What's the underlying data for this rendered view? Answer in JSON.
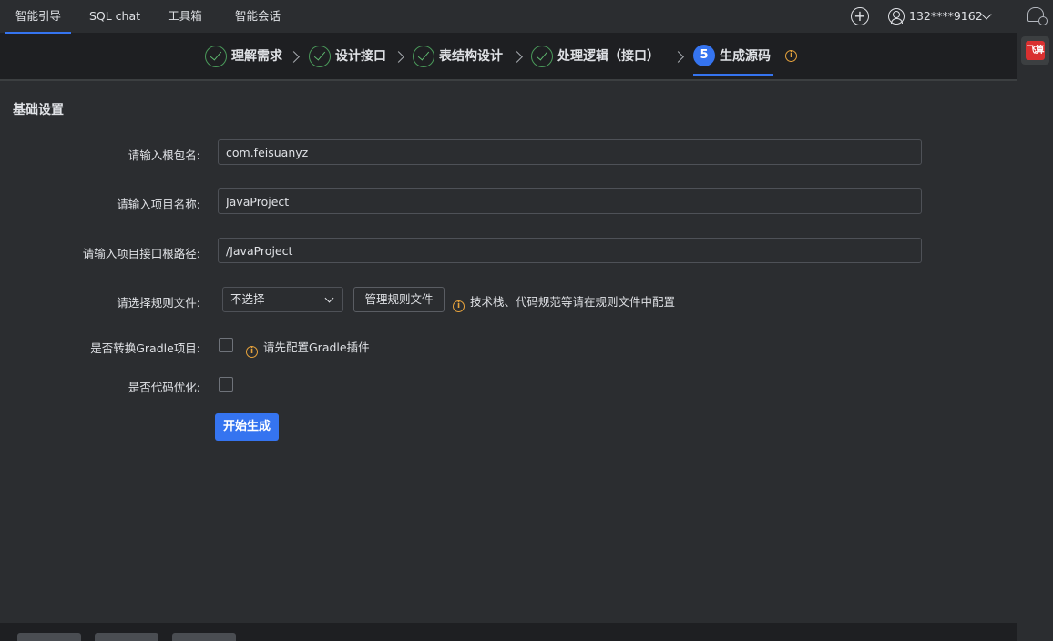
{
  "tabs": [
    {
      "label": "智能引导",
      "active": true
    },
    {
      "label": "SQL chat",
      "active": false
    },
    {
      "label": "工具箱",
      "active": false
    },
    {
      "label": "智能会话",
      "active": false
    }
  ],
  "user": {
    "name": "132****9162"
  },
  "side": {
    "app_logo_text": "飞算"
  },
  "steps": [
    {
      "label": "理解需求",
      "status": "done"
    },
    {
      "label": "设计接口",
      "status": "done"
    },
    {
      "label": "表结构设计",
      "status": "done"
    },
    {
      "label": "处理逻辑（接口）",
      "status": "done"
    },
    {
      "label": "生成源码",
      "status": "active",
      "number": "5"
    }
  ],
  "form": {
    "section_title": "基础设置",
    "root_package_label": "请输入根包名:",
    "root_package_value": "com.feisuanyz",
    "project_name_label": "请输入项目名称:",
    "project_name_value": "JavaProject",
    "api_root_path_label": "请输入项目接口根路径:",
    "api_root_path_value": "/JavaProject",
    "rules_label": "请选择规则文件:",
    "rules_selected": "不选择",
    "manage_rules_button": "管理规则文件",
    "rules_hint": "技术栈、代码规范等请在规则文件中配置",
    "gradle_label": "是否转换Gradle项目:",
    "gradle_checked": false,
    "gradle_hint": "请先配置Gradle插件",
    "optimize_label": "是否代码优化:",
    "optimize_checked": false,
    "start_button": "开始生成"
  },
  "colors": {
    "accent": "#3574f0",
    "success": "#5fb870",
    "warning": "#e6a23c",
    "background": "#2b2d30",
    "dark_background": "#1e1f22"
  },
  "icons": [
    "plus-circle-icon",
    "user-icon",
    "chevron-down-icon",
    "chat-search-icon",
    "check-circle-icon",
    "chevron-right-icon",
    "info-icon"
  ]
}
